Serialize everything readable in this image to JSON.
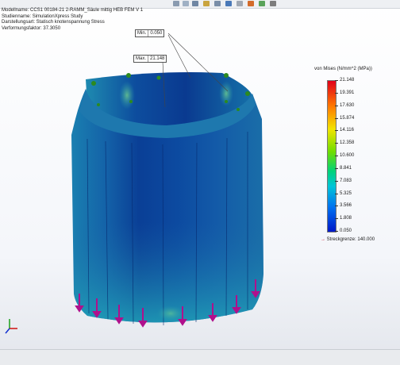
{
  "info": {
    "model": "Modellname: CCS1 00184-21 2-RAMM_Säule mittig HEB FEM V 1",
    "study": "Studienname: SimulationXpress Study",
    "plot": "Darstellungsart: Statisch knotenspannung Stress",
    "deformation": "Verformungsfaktor: 37.3050"
  },
  "probes": {
    "min": {
      "label": "Min.",
      "value": "0.050"
    },
    "max": {
      "label": "Max.",
      "value": "21.148"
    }
  },
  "legend": {
    "title": "von Mises (N/mm^2 (MPa))",
    "ticks": [
      "21.148",
      "19.391",
      "17.630",
      "15.874",
      "14.116",
      "12.358",
      "10.600",
      "8.841",
      "7.083",
      "5.325",
      "3.566",
      "1.808",
      "0.050"
    ],
    "yield_label": "Streckgrenze: 140.000",
    "colors": [
      "#e0001a",
      "#ff7a00",
      "#f2e400",
      "#70dd00",
      "#00d27a",
      "#00c4d8",
      "#0070f0",
      "#0018c8"
    ]
  },
  "toolbar": {
    "icons": [
      "zoom-fit-icon",
      "zoom-area-icon",
      "previous-view-icon",
      "section-view-icon",
      "view-orientation-icon",
      "display-style-icon",
      "hide-show-icon",
      "appearance-icon",
      "scene-icon",
      "view-settings-icon"
    ]
  }
}
